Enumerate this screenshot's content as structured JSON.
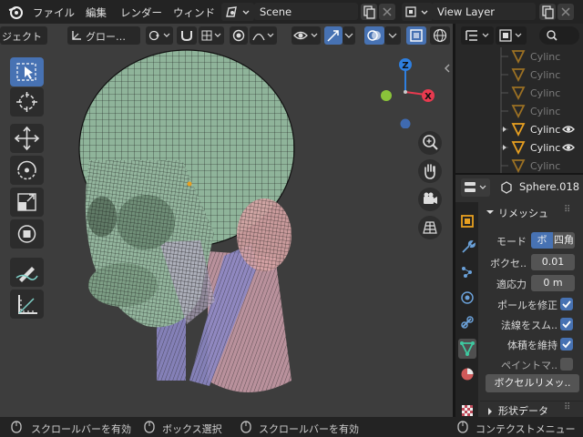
{
  "topbar": {
    "menus": [
      "ファイル",
      "編集",
      "レンダー",
      "ウィンド"
    ],
    "scene": "Scene",
    "view_layer": "View Layer"
  },
  "viewport": {
    "mode_fragment": "ジェクト",
    "transform_orientation": "グロー…",
    "gizmo": {
      "z": "Z",
      "x": "X"
    }
  },
  "outliner": {
    "rows": [
      {
        "label": "Cylinc",
        "highlight": false
      },
      {
        "label": "Cylinc",
        "highlight": false
      },
      {
        "label": "Cylinc",
        "highlight": false
      },
      {
        "label": "Cylinc",
        "highlight": false
      },
      {
        "label": "Cylinc",
        "highlight": true
      },
      {
        "label": "Cylinc",
        "highlight": true
      },
      {
        "label": "Cylinc",
        "highlight": false
      }
    ]
  },
  "properties": {
    "object_name": "Sphere.018",
    "panel_title": "リメッシュ",
    "mode_label": "モード",
    "mode_options": [
      "ボ",
      "四角"
    ],
    "voxel_size_label": "ボクセ..",
    "voxel_size_value": "0.01",
    "adaptivity_label": "適応力",
    "adaptivity_value": "0 m",
    "fix_poles_label": "ポールを修正",
    "smooth_normals_label": "法線をスム..",
    "preserve_volume_label": "体積を維持",
    "paint_mask_label": "ペイントマ..",
    "voxel_remesh_button": "ボクセルリメッ..",
    "shape_data_label": "形状データ"
  },
  "statusbar": {
    "item1": "スクロールバーを有効",
    "item2": "ボックス選択",
    "item3": "スクロールバーを有効",
    "item4": "コンテクストメニュー"
  },
  "colors": {
    "accent": "#4772b3",
    "head_green": "#8fb49a",
    "neck_pink": "#d0a2ae",
    "neck_purple": "#8e86c3",
    "gizmo_x": "#e83a4f",
    "gizmo_z": "#2e7fe0",
    "gizmo_y": "#8ac33a"
  }
}
